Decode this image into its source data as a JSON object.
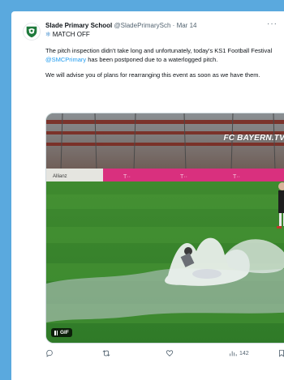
{
  "tweet": {
    "author_name": "Slade Primary School",
    "handle": "@SladePrimarySch",
    "separator": "·",
    "date": "Mar 14",
    "subtitle_icon": "snowflake-icon",
    "subtitle": "MATCH OFF",
    "para1_a": "The pitch inspection didn't take long and unfortunately, today's KS1 Football Festival ",
    "mention": "@SMCPrimary",
    "para1_b": " has been postponed due to a waterlogged pitch.",
    "para2": "We will advise you of plans for rearranging this event as soon as we have them.",
    "more": "···"
  },
  "media": {
    "watermark": "FC BAYERN.TV",
    "gif_label": "GIF",
    "board_text": "Allianz"
  },
  "actions": {
    "views": "142"
  },
  "colors": {
    "background": "#5aa9de",
    "link": "#1d9bf0",
    "text": "#0f1419",
    "muted": "#536471"
  }
}
